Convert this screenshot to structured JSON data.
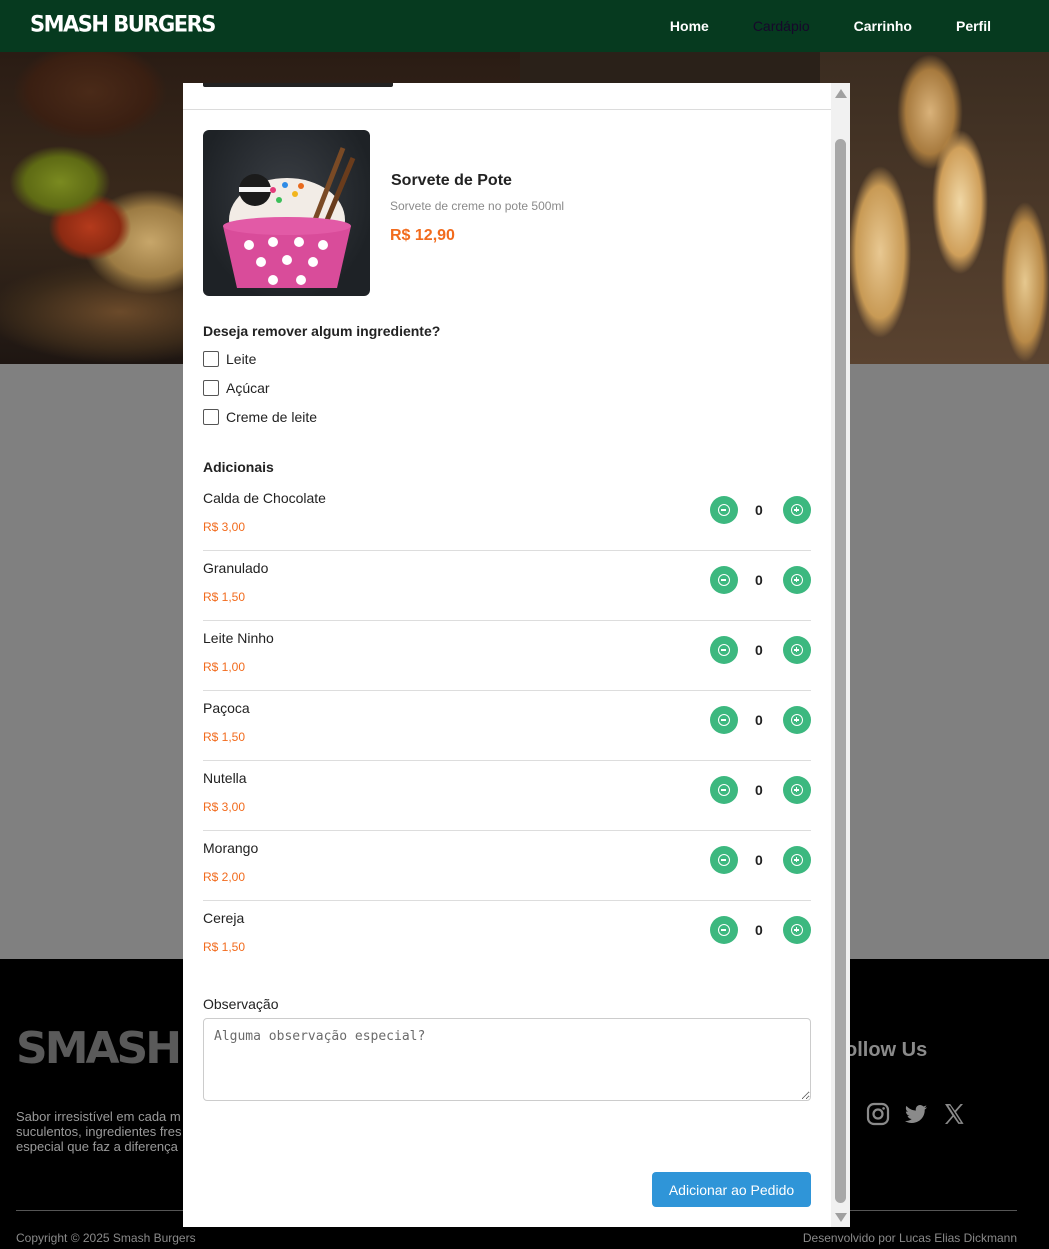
{
  "nav": {
    "logo": "SMASH BURGERS",
    "links": [
      "Home",
      "Cardápio",
      "Carrinho",
      "Perfil"
    ]
  },
  "modal": {
    "product": {
      "name": "Sorvete de Pote",
      "description": "Sorvete de creme no pote 500ml",
      "price": "R$ 12,90"
    },
    "remove_title": "Deseja remover algum ingrediente?",
    "ingredients": [
      "Leite",
      "Açúcar",
      "Creme de leite"
    ],
    "addons_title": "Adicionais",
    "addons": [
      {
        "name": "Calda de Chocolate",
        "price": "R$ 3,00",
        "qty": "0"
      },
      {
        "name": "Granulado",
        "price": "R$ 1,50",
        "qty": "0"
      },
      {
        "name": "Leite Ninho",
        "price": "R$ 1,00",
        "qty": "0"
      },
      {
        "name": "Paçoca",
        "price": "R$ 1,50",
        "qty": "0"
      },
      {
        "name": "Nutella",
        "price": "R$ 3,00",
        "qty": "0"
      },
      {
        "name": "Morango",
        "price": "R$ 2,00",
        "qty": "0"
      },
      {
        "name": "Cereja",
        "price": "R$ 1,50",
        "qty": "0"
      }
    ],
    "observation_label": "Observação",
    "observation_placeholder": "Alguma observação especial?",
    "observation_value": "",
    "add_button": "Adicionar ao Pedido"
  },
  "footer": {
    "logo": "SMASH BU",
    "about_lines": [
      "Sabor irresistível em cada m",
      "suculentos, ingredientes fres",
      "especial que faz a diferença"
    ],
    "follow_title": "ollow Us",
    "social_icons": [
      "facebook-icon",
      "instagram-icon",
      "twitter-icon",
      "x-icon"
    ],
    "copyright": "Copyright © 2025 Smash Burgers",
    "developer": "Desenvolvido por Lucas Elias Dickmann"
  },
  "colors": {
    "navbar": "#063a1f",
    "accent_orange": "#f26b1d",
    "qty_green": "#3cb87f",
    "button_blue": "#2f95d8"
  }
}
